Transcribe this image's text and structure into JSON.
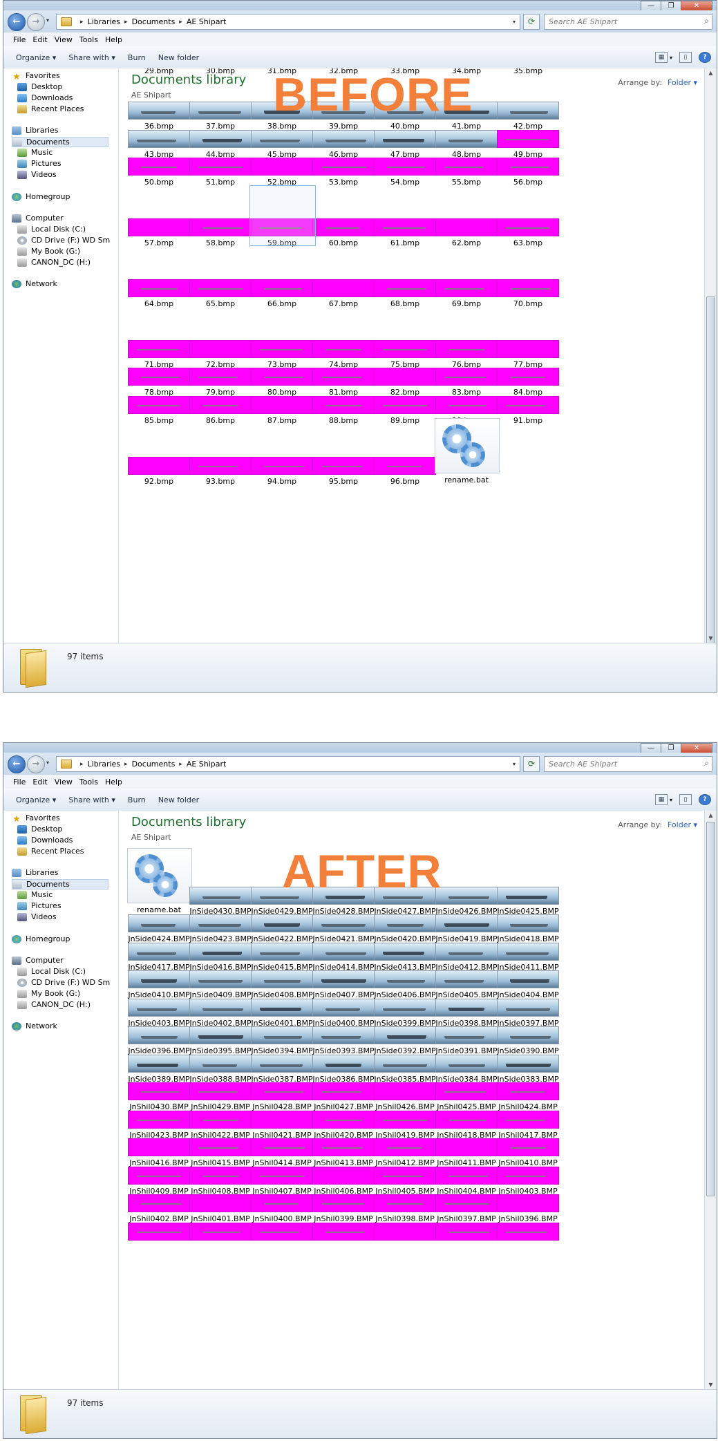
{
  "before": {
    "overlay_label": "BEFORE",
    "window_controls": [
      "—",
      "❐",
      "✕"
    ],
    "breadcrumb": [
      "Libraries",
      "Documents",
      "AE Shipart"
    ],
    "search_placeholder": "Search AE Shipart",
    "menu": [
      "File",
      "Edit",
      "View",
      "Tools",
      "Help"
    ],
    "toolbar": [
      "Organize ▾",
      "Share with ▾",
      "Burn",
      "New folder"
    ],
    "library_title": "Documents library",
    "library_subtitle": "AE Shipart",
    "arrange_label": "Arrange by:",
    "arrange_value": "Folder ▾",
    "nav": [
      {
        "label": "Favorites",
        "icon": "star-icon"
      },
      {
        "label": "Desktop",
        "icon": "desktop-icon"
      },
      {
        "label": "Downloads",
        "icon": "downloads-icon"
      },
      {
        "label": "Recent Places",
        "icon": "recent-places-icon"
      },
      {
        "label": "Libraries",
        "icon": "libraries-icon"
      },
      {
        "label": "Documents",
        "icon": "documents-icon",
        "selected": true
      },
      {
        "label": "Music",
        "icon": "music-icon"
      },
      {
        "label": "Pictures",
        "icon": "pictures-icon"
      },
      {
        "label": "Videos",
        "icon": "videos-icon"
      },
      {
        "label": "Homegroup",
        "icon": "homegroup-icon"
      },
      {
        "label": "Computer",
        "icon": "computer-icon"
      },
      {
        "label": "Local Disk (C:)",
        "icon": "disk-icon"
      },
      {
        "label": "CD Drive (F:) WD Sm",
        "icon": "cd-drive-icon"
      },
      {
        "label": "My Book (G:)",
        "icon": "disk-icon"
      },
      {
        "label": "CANON_DC (H:)",
        "icon": "disk-icon"
      },
      {
        "label": "Network",
        "icon": "network-icon"
      }
    ],
    "status_count": "97 items",
    "rows": [
      {
        "items": [
          "29.bmp",
          "30.bmp",
          "31.bmp",
          "32.bmp",
          "33.bmp",
          "34.bmp",
          "35.bmp"
        ],
        "thumbs": "none"
      },
      {
        "items": [
          "36.bmp",
          "37.bmp",
          "38.bmp",
          "39.bmp",
          "40.bmp",
          "41.bmp",
          "42.bmp"
        ],
        "thumbs": "sea"
      },
      {
        "items": [
          "43.bmp",
          "44.bmp",
          "45.bmp",
          "46.bmp",
          "47.bmp",
          "48.bmp",
          "49.bmp"
        ],
        "thumbs": "sea",
        "last_magenta": true
      },
      {
        "items": [
          "50.bmp",
          "51.bmp",
          "52.bmp",
          "53.bmp",
          "54.bmp",
          "55.bmp",
          "56.bmp"
        ],
        "thumbs": "magenta"
      },
      {
        "items": [
          "57.bmp",
          "58.bmp",
          "59.bmp",
          "60.bmp",
          "61.bmp",
          "62.bmp",
          "63.bmp"
        ],
        "thumbs": "magenta"
      },
      {
        "items": [
          "64.bmp",
          "65.bmp",
          "66.bmp",
          "67.bmp",
          "68.bmp",
          "69.bmp",
          "70.bmp"
        ],
        "thumbs": "magenta"
      },
      {
        "items": [
          "71.bmp",
          "72.bmp",
          "73.bmp",
          "74.bmp",
          "75.bmp",
          "76.bmp",
          "77.bmp"
        ],
        "thumbs": "magenta"
      },
      {
        "items": [
          "78.bmp",
          "79.bmp",
          "80.bmp",
          "81.bmp",
          "82.bmp",
          "83.bmp",
          "84.bmp"
        ],
        "thumbs": "magenta"
      },
      {
        "items": [
          "85.bmp",
          "86.bmp",
          "87.bmp",
          "88.bmp",
          "89.bmp",
          "90.bmp",
          "91.bmp"
        ],
        "thumbs": "magenta"
      },
      {
        "items": [
          "92.bmp",
          "93.bmp",
          "94.bmp",
          "95.bmp",
          "96.bmp",
          "rename.bat"
        ],
        "thumbs": "magenta"
      }
    ]
  },
  "after": {
    "overlay_label": "AFTER",
    "window_controls": [
      "—",
      "❐",
      "✕"
    ],
    "breadcrumb": [
      "Libraries",
      "Documents",
      "AE Shipart"
    ],
    "search_placeholder": "Search AE Shipart",
    "menu": [
      "File",
      "Edit",
      "View",
      "Tools",
      "Help"
    ],
    "toolbar": [
      "Organize ▾",
      "Share with ▾",
      "Burn",
      "New folder"
    ],
    "library_title": "Documents library",
    "library_subtitle": "AE Shipart",
    "arrange_label": "Arrange by:",
    "arrange_value": "Folder ▾",
    "nav": [
      {
        "label": "Favorites",
        "icon": "star-icon"
      },
      {
        "label": "Desktop",
        "icon": "desktop-icon"
      },
      {
        "label": "Downloads",
        "icon": "downloads-icon"
      },
      {
        "label": "Recent Places",
        "icon": "recent-places-icon"
      },
      {
        "label": "Libraries",
        "icon": "libraries-icon"
      },
      {
        "label": "Documents",
        "icon": "documents-icon",
        "selected": true
      },
      {
        "label": "Music",
        "icon": "music-icon"
      },
      {
        "label": "Pictures",
        "icon": "pictures-icon"
      },
      {
        "label": "Videos",
        "icon": "videos-icon"
      },
      {
        "label": "Homegroup",
        "icon": "homegroup-icon"
      },
      {
        "label": "Computer",
        "icon": "computer-icon"
      },
      {
        "label": "Local Disk (C:)",
        "icon": "disk-icon"
      },
      {
        "label": "CD Drive (F:) WD Sm",
        "icon": "cd-drive-icon"
      },
      {
        "label": "My Book (G:)",
        "icon": "disk-icon"
      },
      {
        "label": "CANON_DC (H:)",
        "icon": "disk-icon"
      },
      {
        "label": "Network",
        "icon": "network-icon"
      }
    ],
    "status_count": "97 items",
    "rows": [
      {
        "items": [
          "rename.bat",
          "JnSide0430.BMP",
          "JnSide0429.BMP",
          "JnSide0428.BMP",
          "JnSide0427.BMP",
          "JnSide0426.BMP",
          "JnSide0425.BMP"
        ],
        "thumbs": "sea"
      },
      {
        "items": [
          "JnSide0424.BMP",
          "JnSide0423.BMP",
          "JnSide0422.BMP",
          "JnSide0421.BMP",
          "JnSide0420.BMP",
          "JnSide0419.BMP",
          "JnSide0418.BMP"
        ],
        "thumbs": "sea"
      },
      {
        "items": [
          "JnSide0417.BMP",
          "JnSide0416.BMP",
          "JnSide0415.BMP",
          "JnSide0414.BMP",
          "JnSide0413.BMP",
          "JnSide0412.BMP",
          "JnSide0411.BMP"
        ],
        "thumbs": "sea"
      },
      {
        "items": [
          "JnSide0410.BMP",
          "JnSide0409.BMP",
          "JnSide0408.BMP",
          "JnSide0407.BMP",
          "JnSide0406.BMP",
          "JnSide0405.BMP",
          "JnSide0404.BMP"
        ],
        "thumbs": "sea"
      },
      {
        "items": [
          "JnSide0403.BMP",
          "JnSide0402.BMP",
          "JnSide0401.BMP",
          "JnSide0400.BMP",
          "JnSide0399.BMP",
          "JnSide0398.BMP",
          "JnSide0397.BMP"
        ],
        "thumbs": "sea"
      },
      {
        "items": [
          "JnSide0396.BMP",
          "JnSide0395.BMP",
          "JnSide0394.BMP",
          "JnSide0393.BMP",
          "JnSide0392.BMP",
          "JnSide0391.BMP",
          "JnSide0390.BMP"
        ],
        "thumbs": "sea"
      },
      {
        "items": [
          "JnSide0389.BMP",
          "JnSide0388.BMP",
          "JnSide0387.BMP",
          "JnSide0386.BMP",
          "JnSide0385.BMP",
          "JnSide0384.BMP",
          "JnSide0383.BMP"
        ],
        "thumbs": "sea"
      },
      {
        "items": [
          "JnShil0430.BMP",
          "JnShil0429.BMP",
          "JnShil0428.BMP",
          "JnShil0427.BMP",
          "JnShil0426.BMP",
          "JnShil0425.BMP",
          "JnShil0424.BMP"
        ],
        "thumbs": "magenta"
      },
      {
        "items": [
          "JnShil0423.BMP",
          "JnShil0422.BMP",
          "JnShil0421.BMP",
          "JnShil0420.BMP",
          "JnShil0419.BMP",
          "JnShil0418.BMP",
          "JnShil0417.BMP"
        ],
        "thumbs": "magenta"
      },
      {
        "items": [
          "JnShil0416.BMP",
          "JnShil0415.BMP",
          "JnShil0414.BMP",
          "JnShil0413.BMP",
          "JnShil0412.BMP",
          "JnShil0411.BMP",
          "JnShil0410.BMP"
        ],
        "thumbs": "magenta"
      },
      {
        "items": [
          "JnShil0409.BMP",
          "JnShil0408.BMP",
          "JnShil0407.BMP",
          "JnShil0406.BMP",
          "JnShil0405.BMP",
          "JnShil0404.BMP",
          "JnShil0403.BMP"
        ],
        "thumbs": "magenta"
      },
      {
        "items": [
          "JnShil0402.BMP",
          "JnShil0401.BMP",
          "JnShil0400.BMP",
          "JnShil0399.BMP",
          "JnShil0398.BMP",
          "JnShil0397.BMP",
          "JnShil0396.BMP"
        ],
        "thumbs": "magenta"
      },
      {
        "items": [
          "",
          "",
          "",
          "",
          "",
          "",
          ""
        ],
        "thumbs": "magenta"
      }
    ]
  },
  "colors": {
    "overlay": "#f2803a",
    "magenta": "#ff00ff",
    "library_title": "#1e6e2e",
    "accent": "#2a62b8"
  }
}
